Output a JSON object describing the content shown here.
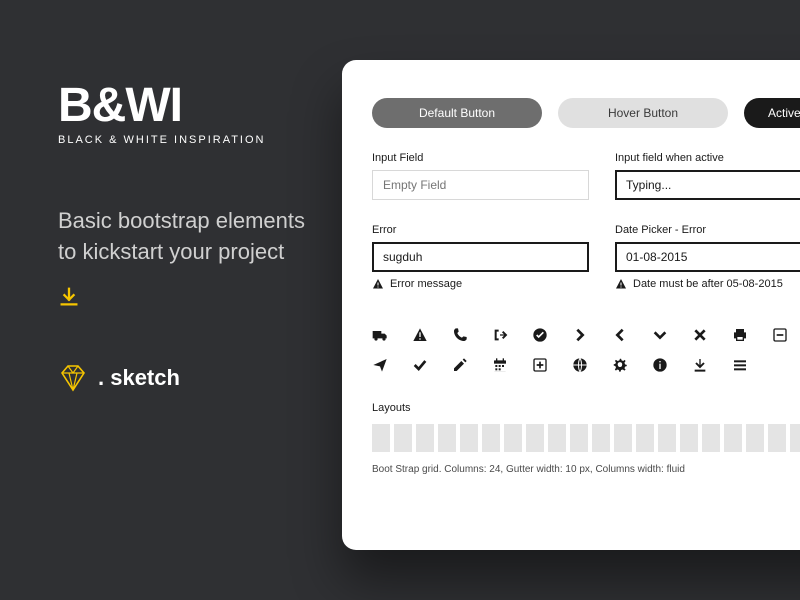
{
  "brand": {
    "logo_title": "B&WI",
    "logo_subtitle": "BLACK & WHITE INSPIRATION",
    "tagline": "Basic bootstrap elements to kickstart your project",
    "sketch_label": ". sketch"
  },
  "buttons": {
    "default": "Default Button",
    "hover": "Hover Button",
    "active": "Active"
  },
  "fields": {
    "input_label": "Input Field",
    "input_placeholder": "Empty Field",
    "active_label": "Input field when active",
    "active_value": "Typing...",
    "error_label": "Error",
    "error_value": "sugduh",
    "error_message": "Error message",
    "date_label": "Date Picker - Error",
    "date_value": "01-08-2015",
    "date_error_message": "Date must be after 05-08-2015"
  },
  "layouts": {
    "label": "Layouts",
    "caption": "Boot Strap grid. Columns: 24, Gutter width: 10 px, Columns width: fluid"
  }
}
